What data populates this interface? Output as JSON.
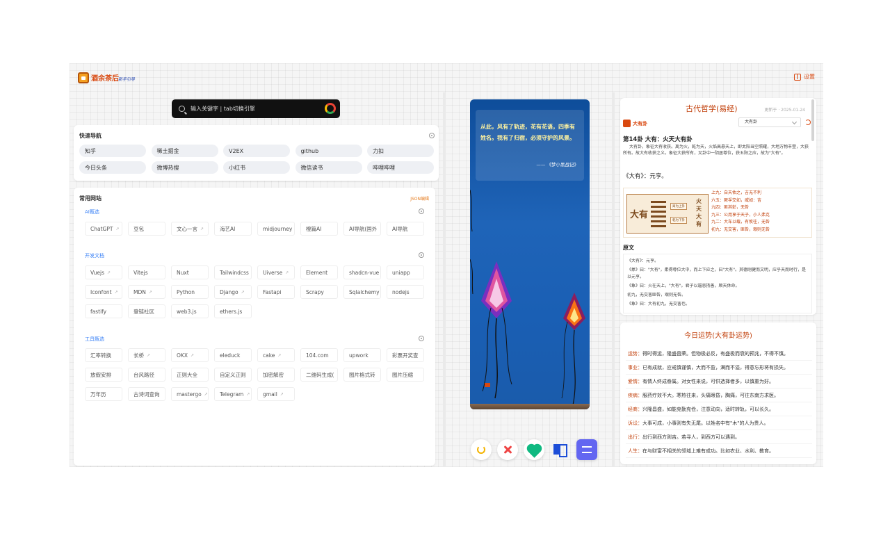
{
  "header": {
    "brand": "酒余茶后",
    "brand_sub": "新手引导",
    "settings_label": "设置"
  },
  "search": {
    "placeholder": "输入关键字 | tab切换引擎"
  },
  "quick_nav": {
    "title": "快速导航",
    "items": [
      "知乎",
      "稀土掘金",
      "V2EX",
      "github",
      "力扣",
      "今日头条",
      "微博热搜",
      "小红书",
      "微信读书",
      "哔哩哔哩"
    ]
  },
  "sites": {
    "title": "常用网站",
    "json_edit": "JSON编辑",
    "sections": [
      {
        "label": "AI甄选",
        "items": [
          {
            "name": "ChatGPT",
            "ext": true
          },
          {
            "name": "豆包",
            "ext": false
          },
          {
            "name": "文心一言",
            "ext": true
          },
          {
            "name": "海艺AI",
            "ext": false
          },
          {
            "name": "midjourney",
            "ext": false
          },
          {
            "name": "橙篇AI",
            "ext": false
          },
          {
            "name": "AI导航(国外",
            "ext": false
          },
          {
            "name": "AI导航",
            "ext": false
          }
        ]
      },
      {
        "label": "开发文档",
        "items": [
          {
            "name": "Vuejs",
            "ext": true
          },
          {
            "name": "Vitejs",
            "ext": false
          },
          {
            "name": "Nuxt",
            "ext": false
          },
          {
            "name": "Tailwindcss",
            "ext": false
          },
          {
            "name": "Uiverse",
            "ext": true
          },
          {
            "name": "Element",
            "ext": false
          },
          {
            "name": "shadcn-vue",
            "ext": false
          },
          {
            "name": "uniapp",
            "ext": false
          },
          {
            "name": "Iconfont",
            "ext": true
          },
          {
            "name": "MDN",
            "ext": true
          },
          {
            "name": "Python",
            "ext": false
          },
          {
            "name": "Django",
            "ext": true
          },
          {
            "name": "Fastapi",
            "ext": false
          },
          {
            "name": "Scrapy",
            "ext": false
          },
          {
            "name": "Sqlalchemy",
            "ext": false
          },
          {
            "name": "nodejs",
            "ext": false
          },
          {
            "name": "fastify",
            "ext": false
          },
          {
            "name": "登链社区",
            "ext": false
          },
          {
            "name": "web3.js",
            "ext": false
          },
          {
            "name": "ethers.js",
            "ext": false
          }
        ]
      },
      {
        "label": "工具甄选",
        "items": [
          {
            "name": "汇率转换",
            "ext": false
          },
          {
            "name": "长桥",
            "ext": true
          },
          {
            "name": "OKX",
            "ext": true
          },
          {
            "name": "eleduck",
            "ext": false
          },
          {
            "name": "cake",
            "ext": true
          },
          {
            "name": "104.com",
            "ext": false
          },
          {
            "name": "upwork",
            "ext": false
          },
          {
            "name": "彩票开奖查",
            "ext": false
          },
          {
            "name": "放假安排",
            "ext": false
          },
          {
            "name": "台风路径",
            "ext": false
          },
          {
            "name": "正则大全",
            "ext": false
          },
          {
            "name": "自定义正则",
            "ext": false
          },
          {
            "name": "加密解密",
            "ext": false
          },
          {
            "name": "二维码生成(",
            "ext": false
          },
          {
            "name": "图片格式转",
            "ext": false
          },
          {
            "name": "图片压缩",
            "ext": false
          },
          {
            "name": "万年历",
            "ext": false
          },
          {
            "name": "古诗词查询",
            "ext": false
          },
          {
            "name": "mastergo",
            "ext": true
          },
          {
            "name": "Telegram",
            "ext": true
          },
          {
            "name": "gmail",
            "ext": true
          }
        ]
      }
    ]
  },
  "quote": {
    "text": "从此，风有了轨迹，花有花语，四季有姓名。我有了归宿，必须守护的风景。",
    "source": "—— 《梦小黑战记》"
  },
  "actions": {
    "items": [
      "undo",
      "close",
      "like",
      "read",
      "switch"
    ]
  },
  "philosophy": {
    "title": "古代哲学(易经)",
    "updated": "更新于 · 2025-01-24",
    "gua_tag": "大有卦",
    "select_value": "大有卦",
    "heading": "第14卦 大有：火天大有卦",
    "description": "大有卦，象征大有收获。离为火，乾为天，火焰高悬天上，即太阳当空照耀，大地万物丰登，大获所有。故大有收获之义。象征大获所有，又卦中一阴居尊位，获五阳之应，故为\"大有\"。",
    "name_line": "《大有》：元亨。",
    "big_char": "大有",
    "upper_tri": "离为上卦",
    "lower_tri": "乾为下卦",
    "vertical": "火天大有",
    "yao": [
      "上九：自天佑之，吉无不利",
      "六五：厥孚交如，威如：吉",
      "九四：匪其彭，无咎",
      "九三：公用享于天子，小人弗克",
      "九二：大车以载，有攸往，无咎",
      "初九：无交害，匪咎，艰则无咎"
    ],
    "original_title": "原文",
    "original": [
      "《大有》：元亨。",
      "《彖》曰：\"大有\"，柔得尊位大中，而上下应之，曰\"大有\"。其德刚健而文明，应乎天而时行，是以元亨。",
      "《象》曰：火在天上，\"大有\"。君子以遏恶扬善，顺天休命。",
      "初九，无交害匪咎，艰则无咎。",
      "《象》曰：大有初九，无交害也。"
    ]
  },
  "fortune": {
    "title": "今日运势(大有卦运势)",
    "rows": [
      {
        "key": "运势：",
        "value": "得时得运，隆盛昌荣。但物极必反，有盛极而衰的预兆，不得不慎。"
      },
      {
        "key": "事业：",
        "value": "已有成就，应戒慎谨慎，大而不盈，满而不溢，得意忘形将有损失。"
      },
      {
        "key": "爱情：",
        "value": "有情人终成眷属。对女性来说，可供选择者多，以慎重为好。"
      },
      {
        "key": "疾病：",
        "value": "服药疗效不大。寒热往来，头痛眼昏，胸痛，可往东南方求医。"
      },
      {
        "key": "经商：",
        "value": "兴隆昌盛，如能克勤克俭，注意动向，适时转轨，可以长久。"
      },
      {
        "key": "诉讼：",
        "value": "大事可成，小事则有失无尾。以姓名中有\"木\"的人为贵人。"
      },
      {
        "key": "出行：",
        "value": "出行到西方则吉。若寻人，到西方可以遇到。"
      },
      {
        "key": "人生：",
        "value": "在与财富不相关的领域上难有成功。比如农业、水利、教育。"
      }
    ]
  },
  "colors": {
    "accent": "#c2410c",
    "link": "#3b82f6",
    "search_bg": "#111111"
  }
}
